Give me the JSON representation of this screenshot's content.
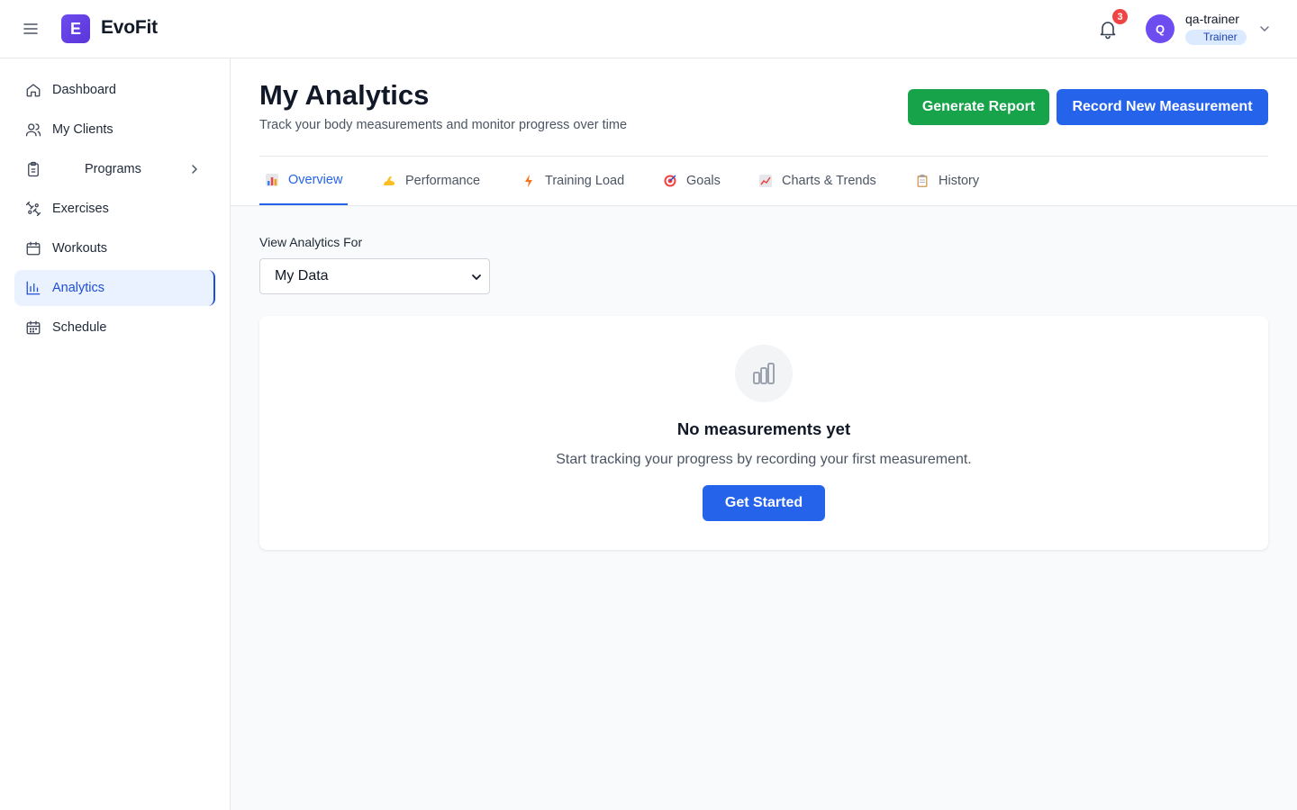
{
  "app": {
    "logo_letter": "E",
    "name": "EvoFit"
  },
  "header": {
    "notification_count": "3",
    "user": {
      "initial": "Q",
      "name": "qa-trainer",
      "role": "Trainer"
    }
  },
  "sidebar": {
    "items": [
      {
        "label": "Dashboard",
        "icon": "home-icon"
      },
      {
        "label": "My Clients",
        "icon": "users-icon"
      },
      {
        "label": "Programs",
        "icon": "clipboard-icon"
      },
      {
        "label": "Exercises",
        "icon": "exercises-icon"
      },
      {
        "label": "Workouts",
        "icon": "calendar-icon"
      },
      {
        "label": "Analytics",
        "icon": "bar-chart-icon",
        "active": true
      },
      {
        "label": "Schedule",
        "icon": "schedule-icon"
      }
    ]
  },
  "page": {
    "title": "My Analytics",
    "subtitle": "Track your body measurements and monitor progress over time",
    "generate_report_label": "Generate Report",
    "record_measurement_label": "Record New Measurement"
  },
  "tabs": [
    {
      "label": "Overview",
      "icon": "bar-chart-emoji-icon",
      "active": true
    },
    {
      "label": "Performance",
      "icon": "flexed-biceps-icon"
    },
    {
      "label": "Training Load",
      "icon": "lightning-icon"
    },
    {
      "label": "Goals",
      "icon": "target-icon"
    },
    {
      "label": "Charts & Trends",
      "icon": "chart-increasing-icon"
    },
    {
      "label": "History",
      "icon": "clipboard-emoji-icon"
    }
  ],
  "filter": {
    "label": "View Analytics For",
    "selected": "My Data"
  },
  "empty_state": {
    "title": "No measurements yet",
    "text": "Start tracking your progress by recording your first measurement.",
    "button_label": "Get Started"
  },
  "colors": {
    "primary": "#2563eb",
    "success": "#16a34a",
    "brand": "#6d4cf0",
    "badge": "#ef4444"
  }
}
